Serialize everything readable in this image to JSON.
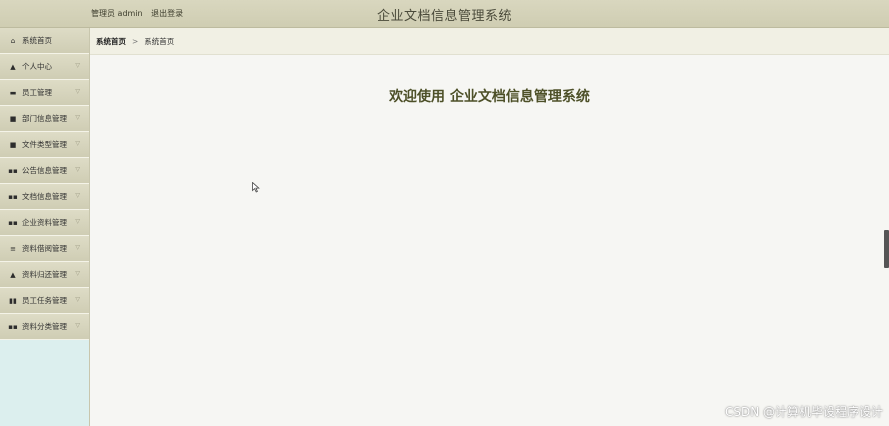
{
  "header": {
    "user_label": "管理员 admin",
    "logout_label": "退出登录",
    "app_title": "企业文档信息管理系统"
  },
  "sidebar": {
    "items": [
      {
        "label": "系统首页",
        "icon": "home-icon",
        "glyph": "⌂",
        "has_chevron": false
      },
      {
        "label": "个人中心",
        "icon": "user-icon",
        "glyph": "▲",
        "has_chevron": true
      },
      {
        "label": "员工管理",
        "icon": "briefcase-icon",
        "glyph": "▬",
        "has_chevron": true
      },
      {
        "label": "部门信息管理",
        "icon": "checkbox-icon",
        "glyph": "■",
        "has_chevron": true
      },
      {
        "label": "文件类型管理",
        "icon": "lock-icon",
        "glyph": "■",
        "has_chevron": true
      },
      {
        "label": "公告信息管理",
        "icon": "grid-icon",
        "glyph": "▪▪",
        "has_chevron": true
      },
      {
        "label": "文档信息管理",
        "icon": "grid-icon",
        "glyph": "▪▪",
        "has_chevron": true
      },
      {
        "label": "企业资料管理",
        "icon": "grid-icon",
        "glyph": "▪▪",
        "has_chevron": true
      },
      {
        "label": "资料借阅管理",
        "icon": "list-icon",
        "glyph": "≡",
        "has_chevron": true
      },
      {
        "label": "资料归还管理",
        "icon": "user-icon",
        "glyph": "▲",
        "has_chevron": true
      },
      {
        "label": "员工任务管理",
        "icon": "chart-icon",
        "glyph": "▮▮",
        "has_chevron": true
      },
      {
        "label": "资料分类管理",
        "icon": "grid-icon",
        "glyph": "▪▪",
        "has_chevron": true
      }
    ]
  },
  "breadcrumb": {
    "home": "系统首页",
    "separator": ">",
    "current": "系统首页"
  },
  "main": {
    "welcome": "欢迎使用 企业文档信息管理系统"
  },
  "watermark": "CSDN @计算机毕设程序设计",
  "colors": {
    "topbar": "#d4d2b8",
    "sidebar_bg": "#dcefee",
    "welcome_text": "#4d5028"
  }
}
